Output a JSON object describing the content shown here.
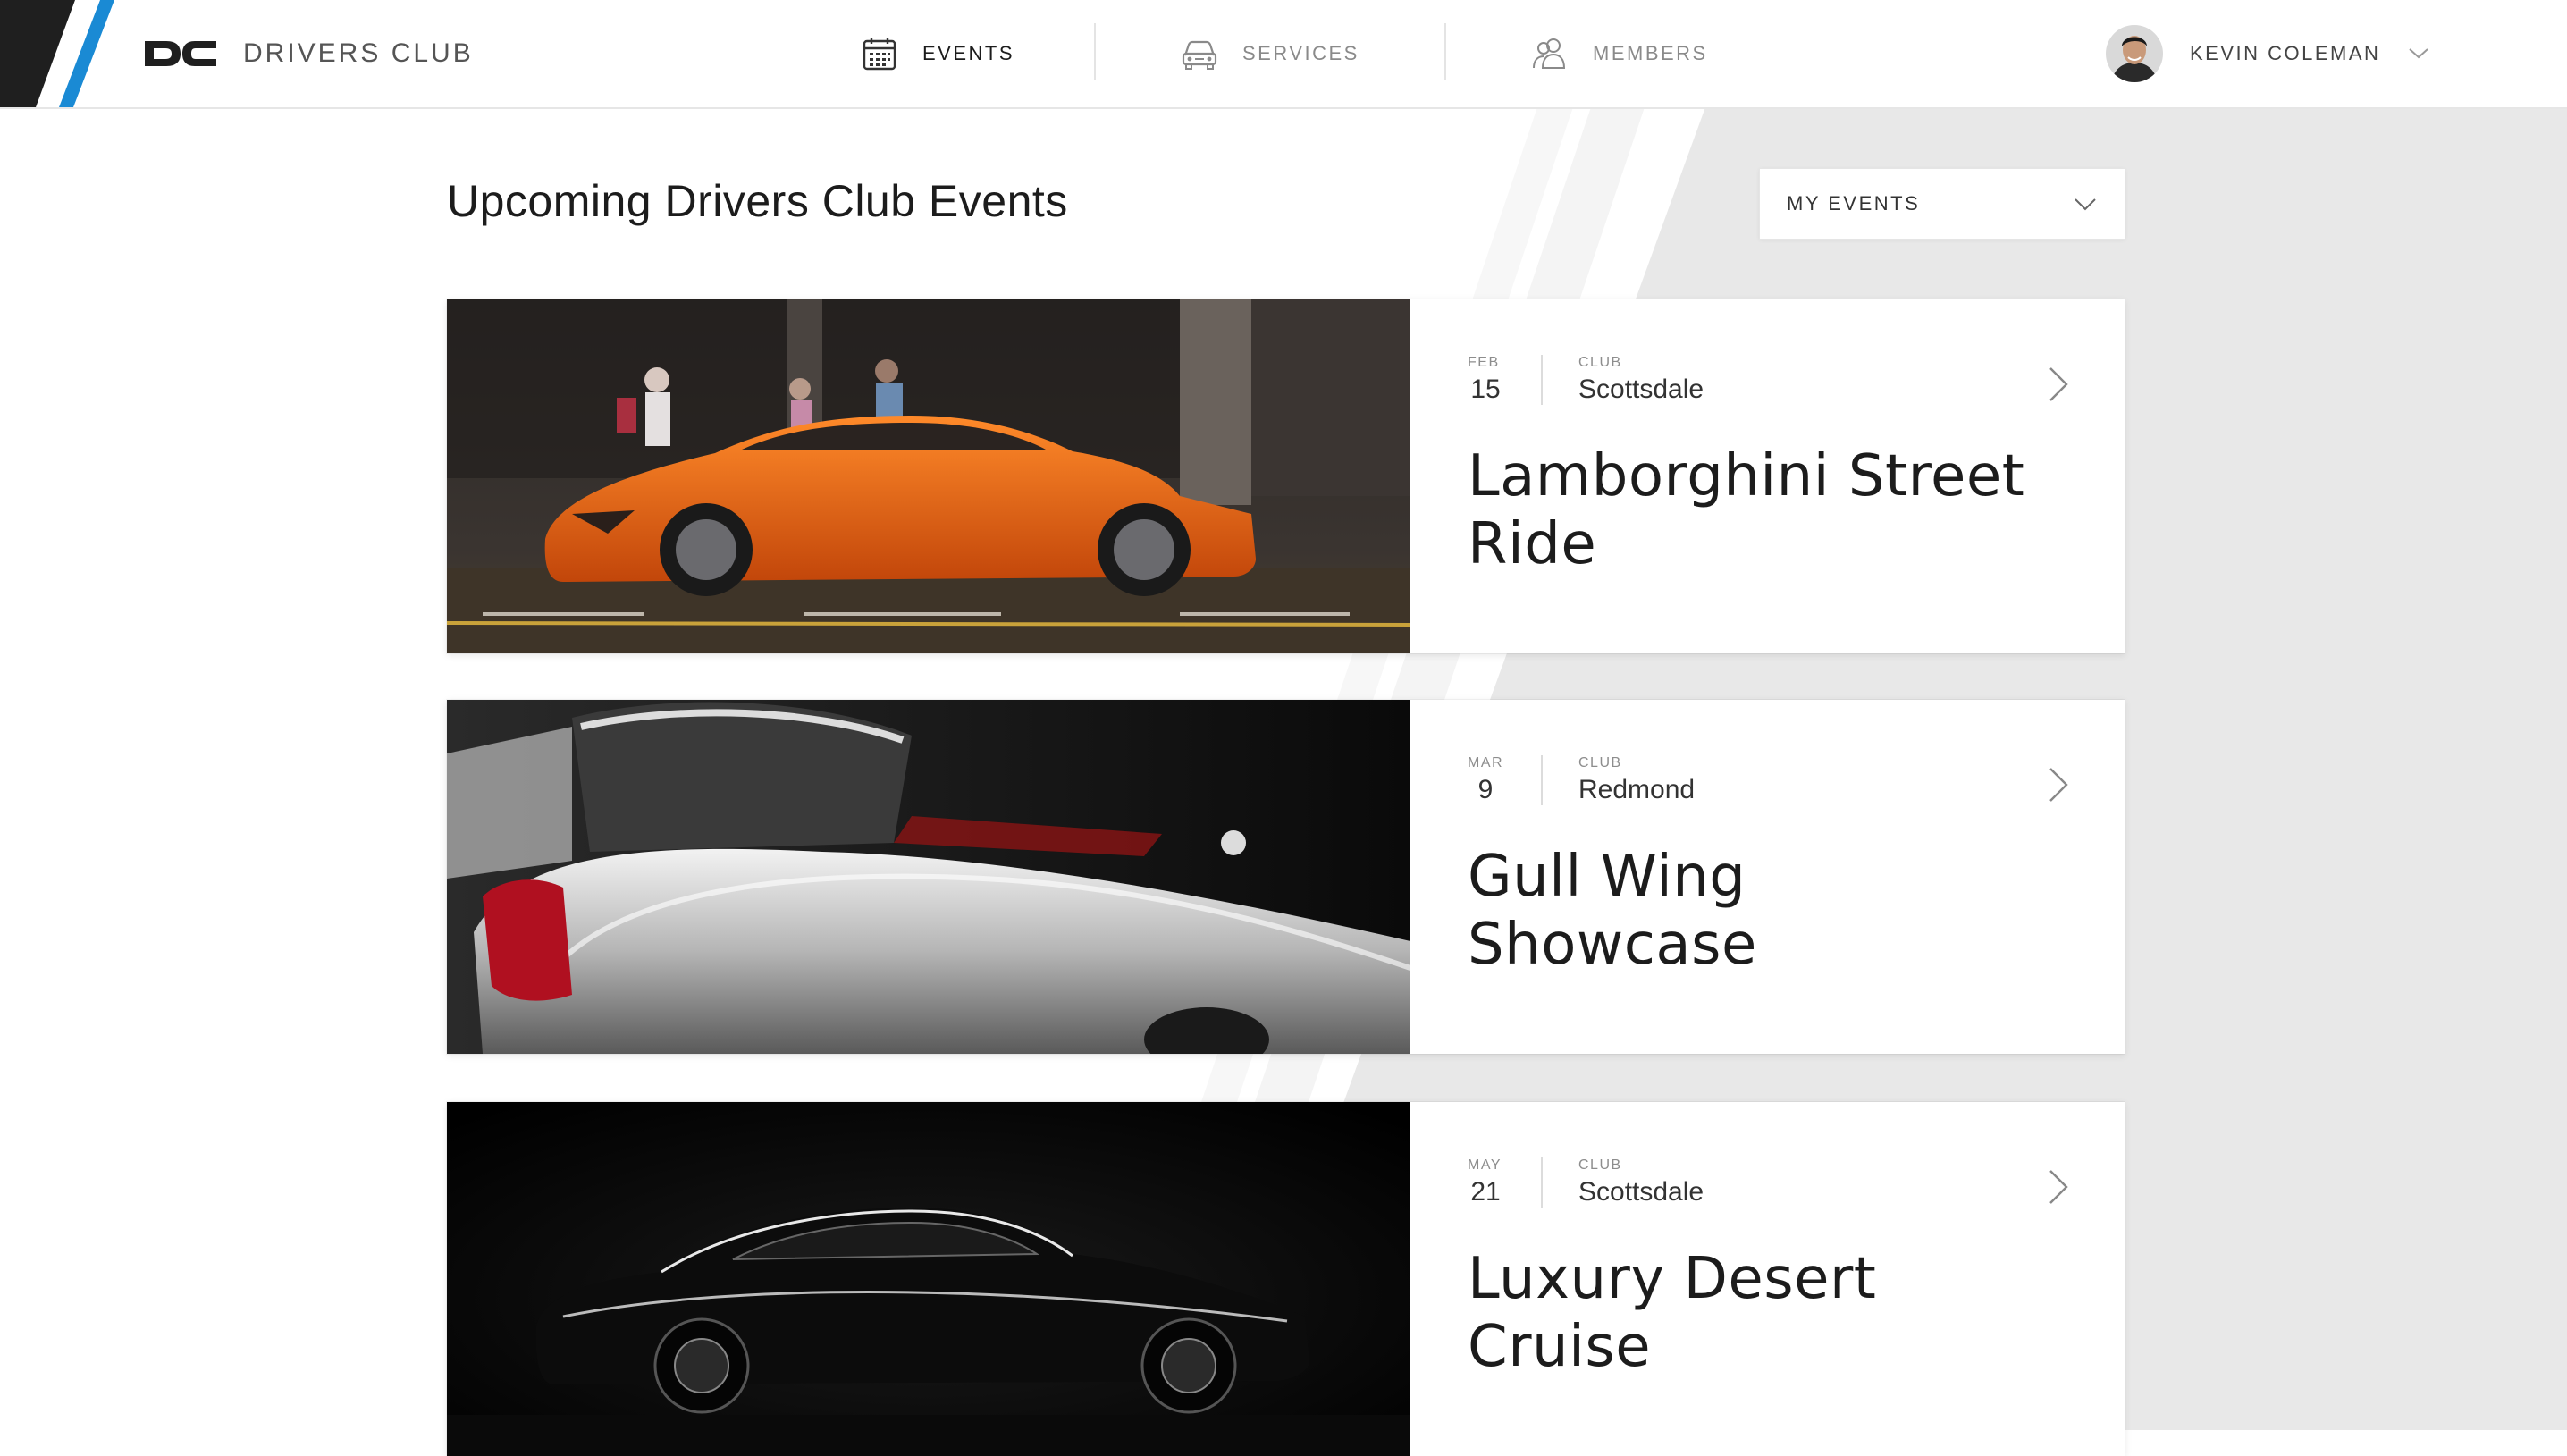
{
  "brand": {
    "mark": "DC",
    "name": "DRIVERS CLUB",
    "accent": "#1a8ad4",
    "dark": "#1f1f1f"
  },
  "nav": [
    {
      "label": "EVENTS",
      "icon": "calendar-icon",
      "active": true
    },
    {
      "label": "SERVICES",
      "icon": "car-icon",
      "active": false
    },
    {
      "label": "MEMBERS",
      "icon": "members-icon",
      "active": false
    }
  ],
  "user": {
    "name": "KEVIN COLEMAN",
    "icon": "chevron-down-icon"
  },
  "page": {
    "title": "Upcoming Drivers Club Events",
    "filter_label": "MY EVENTS"
  },
  "events": [
    {
      "month": "FEB",
      "day": "15",
      "club_label": "CLUB",
      "club": "Scottsdale",
      "title": "Lamborghini Street Ride",
      "image": "orange sports car photo"
    },
    {
      "month": "MAR",
      "day": "9",
      "club_label": "CLUB",
      "club": "Redmond",
      "title": "Gull Wing Showcase",
      "image": "silver gull wing car photo"
    },
    {
      "month": "MAY",
      "day": "21",
      "club_label": "CLUB",
      "club": "Scottsdale",
      "title": "Luxury Desert Cruise",
      "image": "black sedan photo"
    }
  ]
}
